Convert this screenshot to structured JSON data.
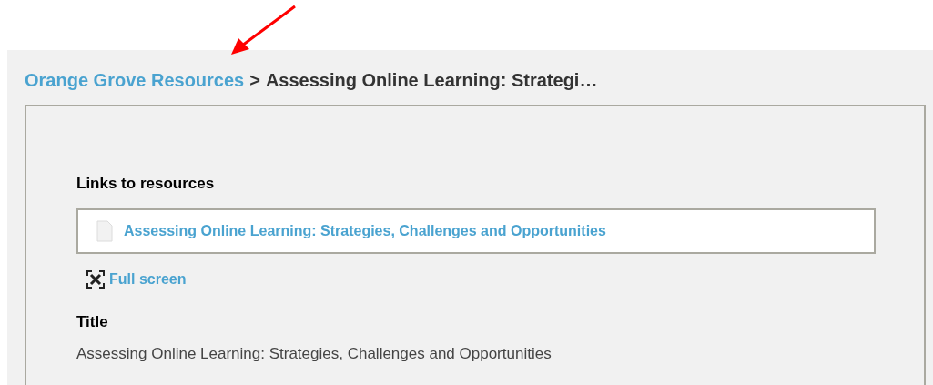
{
  "breadcrumb": {
    "link": "Orange Grove Resources",
    "separator": ">",
    "current": "Assessing Online Learning: Strategi…"
  },
  "links_section": {
    "heading": "Links to resources",
    "links": [
      {
        "label": "Assessing Online Learning: Strategies, Challenges and Opportunities"
      }
    ],
    "full_screen": "Full screen"
  },
  "fields": [
    {
      "label": "Title",
      "value": "Assessing Online Learning: Strategies, Challenges and Opportunities"
    }
  ]
}
